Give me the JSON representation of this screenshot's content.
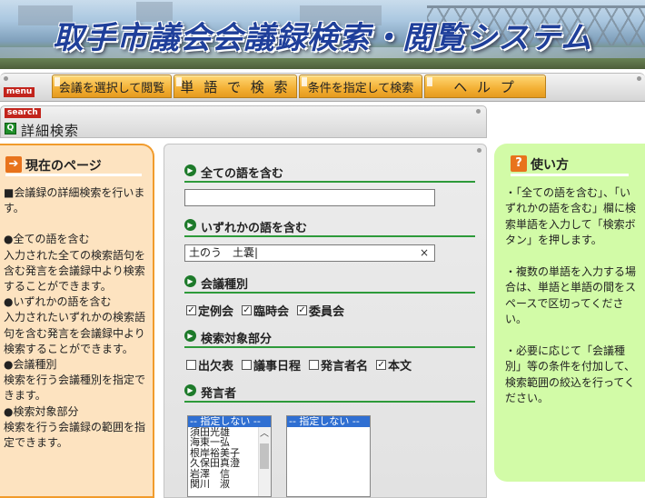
{
  "banner": {
    "title": "取手市議会会議録検索・閲覧システム"
  },
  "menu": {
    "tag": "menu",
    "tabs": [
      {
        "label": "会議を選択して閲覧"
      },
      {
        "label": "単 語 で 検 索"
      },
      {
        "label": "条件を指定して検索"
      },
      {
        "label": "ヘ ル プ"
      }
    ]
  },
  "search_header": {
    "tag": "search",
    "title": "詳細検索",
    "icon_glyph": "Q"
  },
  "left_panel": {
    "heading": "現在のページ",
    "intro": "■会議録の詳細検索を行います。",
    "bullets": [
      {
        "title": "●全ての語を含む",
        "text": "入力された全ての検索語句を含む発言を会議録中より検索することができます。"
      },
      {
        "title": "●いずれかの語を含む",
        "text": "入力されたいずれかの検索語句を含む発言を会議録中より検索することができます。"
      },
      {
        "title": "●会議種別",
        "text": "検索を行う会議種別を指定できます。"
      },
      {
        "title": "●検索対象部分",
        "text": "検索を行う会議録の範囲を指定できます。"
      }
    ]
  },
  "form": {
    "all_words": {
      "label": "全ての語を含む",
      "value": ""
    },
    "any_words": {
      "label": "いずれかの語を含む",
      "value": "土のう　土嚢|",
      "clear": "×"
    },
    "meeting_type": {
      "label": "会議種別",
      "options": [
        {
          "label": "定例会",
          "checked": true
        },
        {
          "label": "臨時会",
          "checked": true
        },
        {
          "label": "委員会",
          "checked": true
        }
      ]
    },
    "target": {
      "label": "検索対象部分",
      "options": [
        {
          "label": "出欠表",
          "checked": false
        },
        {
          "label": "議事日程",
          "checked": false
        },
        {
          "label": "発言者名",
          "checked": false
        },
        {
          "label": "本文",
          "checked": true
        }
      ]
    },
    "speaker": {
      "label": "発言者",
      "list1": {
        "selected": "-- 指定しない --",
        "items": [
          "須田光雄",
          "海東一弘",
          "根岸裕美子",
          "久保田真澄",
          "岩澤　信",
          "関川　淑"
        ]
      },
      "list2": {
        "selected": "-- 指定しない --"
      }
    }
  },
  "right_panel": {
    "heading": "使い方",
    "paragraphs": [
      "・「全ての語を含む」、「いずれかの語を含む」欄に検索単語を入力して「検索ボタン」を押します。",
      "・複数の単語を入力する場合は、単語と単語の間をスペースで区切ってください。",
      "・必要に応じて「会議種別」等の条件を付加して、検索範囲の絞込を行ってください。"
    ]
  },
  "colors": {
    "accent_orange": "#f3b035",
    "accent_green": "#2d9a3a",
    "help_bg": "#d2fba7",
    "left_bg": "#fde3c0"
  }
}
